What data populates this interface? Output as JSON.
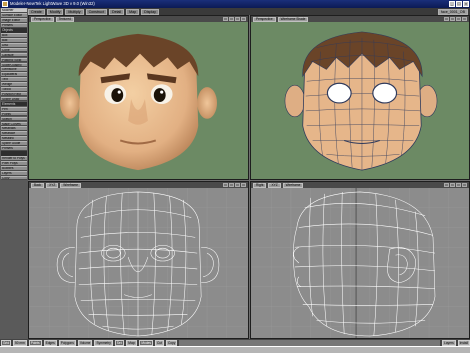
{
  "window": {
    "title": "Modeler-NewTek LightWave 3D v 9.0 (Win32)"
  },
  "menus": [
    {
      "label": "Create"
    },
    {
      "label": "Modify"
    },
    {
      "label": "Multiply"
    },
    {
      "label": "Construct"
    },
    {
      "label": "Detail"
    },
    {
      "label": "Map"
    },
    {
      "label": "Display"
    }
  ],
  "layer_field": "face_0001_OB",
  "sidebar": {
    "top_items": [
      "Modeler",
      "Surface Editor",
      "Image Editor",
      "Presets"
    ],
    "sections": [
      {
        "head": "Objects",
        "items": [
          "Box",
          "Ball",
          "Disc",
          "Cone",
          "Capsule",
          "Platonic Solid",
          "SuperQuadric",
          "Gemstone",
          "Equilateral",
          "Text",
          "Wedge",
          "Toroid",
          "Polygon Rect",
          "Spline Draw"
        ]
      },
      {
        "head": "Elements",
        "items": [
          "Pen",
          "Points",
          "Sketch",
          "Make Curves",
          "Metaballs",
          "Metaface",
          "Metalink",
          "Spline Guide",
          "Presets"
        ]
      },
      {
        "head": "",
        "items": [
          "Render to Polys",
          "Pixel Polys",
          "Bubbles",
          "Layers",
          "Copy"
        ]
      }
    ]
  },
  "viewports": {
    "top_left": {
      "projection": "Perspective",
      "mode": "Textured"
    },
    "top_right": {
      "projection": "Perspective",
      "mode": "Wireframe Shade"
    },
    "bottom_left": {
      "projection": "Back",
      "zoom": "XYZ",
      "mode": "Wireframe"
    },
    "bottom_right": {
      "projection": "Right",
      "zoom": "XYZ",
      "mode": "Wireframe"
    }
  },
  "statusbar": [
    {
      "label": "Grid",
      "dark": true
    },
    {
      "label": "50 mm",
      "dark": false
    },
    {
      "label": "Points",
      "dark": true
    },
    {
      "label": "Edges",
      "dark": false
    },
    {
      "label": "Polygons",
      "dark": false
    },
    {
      "label": "Volume",
      "dark": false
    },
    {
      "label": "Symmetry",
      "dark": false
    },
    {
      "label": "Sel: ",
      "dark": true
    },
    {
      "label": "Map: ",
      "dark": false
    },
    {
      "label": "Modes",
      "dark": true
    },
    {
      "label": "Cut",
      "dark": false
    },
    {
      "label": "Copy",
      "dark": false
    },
    {
      "label": "Layers",
      "dark": false
    },
    {
      "label": "Install",
      "dark": false
    }
  ],
  "colors": {
    "viewport_bg_perspective": "#6c8a64",
    "viewport_bg_ortho": "#8c8c8c",
    "skin": "#e7b98c",
    "hair": "#6a4428",
    "wire": "#ffffff",
    "mesh_line": "#2f3a5c"
  }
}
